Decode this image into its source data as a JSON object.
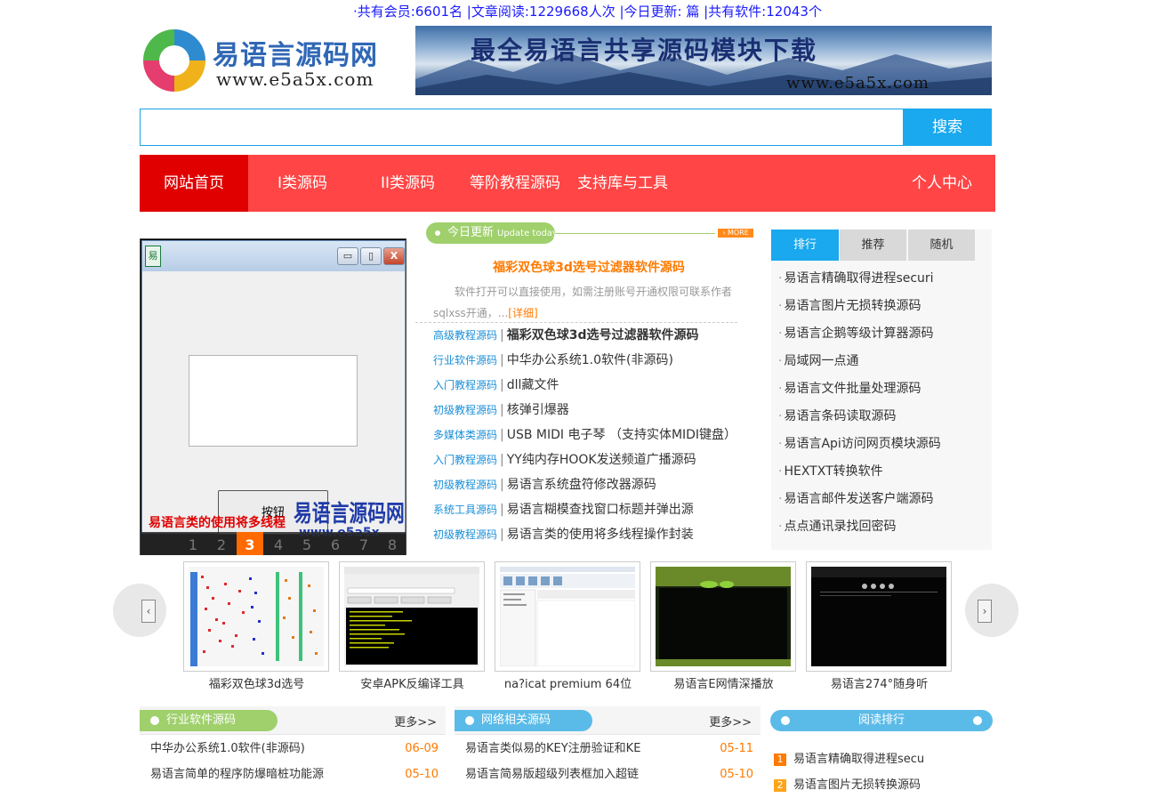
{
  "stats": {
    "text": "·共有会员:6601名 |文章阅读:1229668人次 |今日更新: 篇 |共有软件:12043个"
  },
  "header": {
    "logo_title": "易语言源码网",
    "logo_url": "www.e5a5x.com",
    "banner_title": "最全易语言共享源码模块下载",
    "banner_url": "www.e5a5x.com"
  },
  "search": {
    "placeholder": "",
    "button_label": "搜索"
  },
  "nav": {
    "items": [
      {
        "label": "网站首页"
      },
      {
        "label": "I类源码"
      },
      {
        "label": "II类源码"
      },
      {
        "label": "等阶教程源码"
      },
      {
        "label": "支持库与工具"
      },
      {
        "label": "个人中心"
      }
    ]
  },
  "slideshow": {
    "window_icon_text": "易",
    "window_button_text": "按钮",
    "watermark": "易语言源码网",
    "watermark_url": "www.e5a5x",
    "caption": "易语言类的使用将多线程",
    "pages": [
      "1",
      "2",
      "3",
      "4",
      "5",
      "6",
      "7",
      "8"
    ],
    "active_page": "3"
  },
  "today": {
    "heading": "今日更新",
    "heading_en": "Update today",
    "more": "MORE",
    "featured_title": "福彩双色球3d选号过滤器软件源码",
    "featured_desc": "软件打开可以直接使用，如需注册账号开通权限可联系作者sqlxss开通，...",
    "featured_link": "[详细]",
    "items": [
      {
        "category": "高级教程源码",
        "title": "福彩双色球3d选号过滤器软件源码"
      },
      {
        "category": "行业软件源码",
        "title": "中华办公系统1.0软件(非源码)"
      },
      {
        "category": "入门教程源码",
        "title": "dll藏文件"
      },
      {
        "category": "初级教程源码",
        "title": "核弹引爆器"
      },
      {
        "category": "多媒体类源码",
        "title": "USB MIDI 电子琴 （支持实体MIDI键盘）"
      },
      {
        "category": "入门教程源码",
        "title": "YY纯内存HOOK发送频道广播源码"
      },
      {
        "category": "初级教程源码",
        "title": "易语言系统盘符修改器源码"
      },
      {
        "category": "系统工具源码",
        "title": "易语言糊模查找窗口标题并弹出源"
      },
      {
        "category": "初级教程源码",
        "title": "易语言类的使用将多线程操作封装"
      }
    ]
  },
  "ranking": {
    "tabs": [
      {
        "label": "排行"
      },
      {
        "label": "推荐"
      },
      {
        "label": "随机"
      }
    ],
    "items": [
      "易语言精确取得进程securi",
      "易语言图片无损转换源码",
      "易语言企鹅等级计算器源码",
      "局域网一点通",
      "易语言文件批量处理源码",
      "易语言条码读取源码",
      "易语言Api访问网页模块源码",
      "HEXTXT转换软件",
      "易语言邮件发送客户端源码",
      "点点通讯录找回密码"
    ]
  },
  "strip": {
    "left_arrow": "‹",
    "right_arrow": "›",
    "items": [
      {
        "caption": "福彩双色球3d选号"
      },
      {
        "caption": "安卓APK反编译工具"
      },
      {
        "caption": "na?icat premium 64位"
      },
      {
        "caption": "易语言E网情深播放"
      },
      {
        "caption": "易语言274°随身听"
      }
    ]
  },
  "boxes": {
    "industry": {
      "title": "行业软件源码",
      "more": "更多>>",
      "color": "#9fd06c",
      "rows": [
        {
          "title": "中华办公系统1.0软件(非源码)",
          "date": "06-09"
        },
        {
          "title": "易语言简单的程序防爆暗桩功能源",
          "date": "05-10"
        }
      ]
    },
    "network": {
      "title": "网络相关源码",
      "more": "更多>>",
      "color": "#5bbbe8",
      "rows": [
        {
          "title": "易语言类似易的KEY注册验证和KE",
          "date": "05-11"
        },
        {
          "title": "易语言简易版超级列表框加入超链",
          "date": "05-10"
        }
      ]
    },
    "reading": {
      "title": "阅读排行",
      "color": "#5bbbe8",
      "rows": [
        {
          "num": "1",
          "title": "易语言精确取得进程secu"
        },
        {
          "num": "2",
          "title": "易语言图片无损转换源码"
        }
      ]
    }
  }
}
